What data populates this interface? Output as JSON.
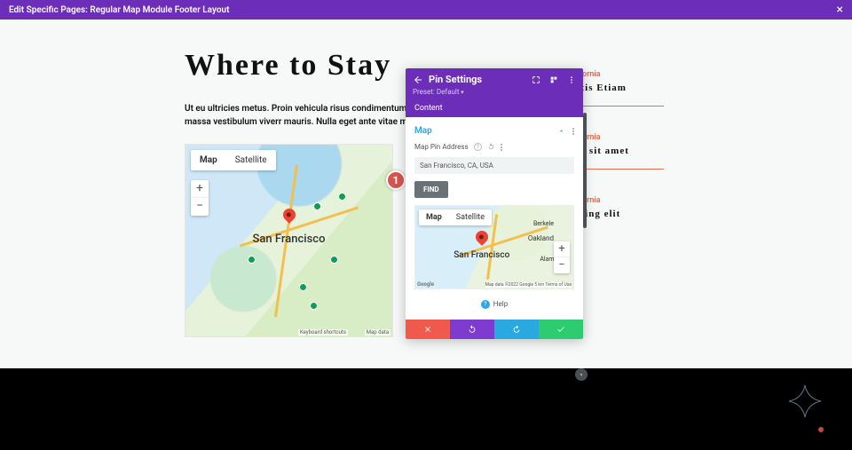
{
  "topbar": {
    "title": "Edit Specific Pages: Regular Map Module Footer Layout"
  },
  "page": {
    "title": "Where to Stay",
    "body": "Ut eu ultricies metus. Proin vehicula risus condimentum molestie. Integer in elit pulvinar massa vestibulum viverr mauris. Nulla eget ante vitae mi tempor luctus."
  },
  "map_large": {
    "map_tab": "Map",
    "sat_tab": "Satellite",
    "label": "San Francisco",
    "kb": "Keyboard shortcuts",
    "attr": "Map data"
  },
  "badge": "1",
  "sideitems": [
    {
      "cat": "lifornia",
      "title": "atis Etiam"
    },
    {
      "cat": "lifornia",
      "title": "or sit amet"
    },
    {
      "cat": "lifornia",
      "title": "scing elit"
    }
  ],
  "panel": {
    "title": "Pin Settings",
    "preset": "Preset: Default",
    "tab": "Content",
    "group": "Map",
    "field_label": "Map Pin Address",
    "address": "San Francisco, CA, USA",
    "find": "FIND",
    "mini": {
      "map_tab": "Map",
      "sat_tab": "Satellite",
      "label": "San Francisco",
      "oakland": "Oakland",
      "alameda": "Alameda",
      "berkeley": "Berkele",
      "google": "Google",
      "attr": "Map data ©2022 Google   5 km   Terms of Use"
    },
    "help": "Help"
  }
}
